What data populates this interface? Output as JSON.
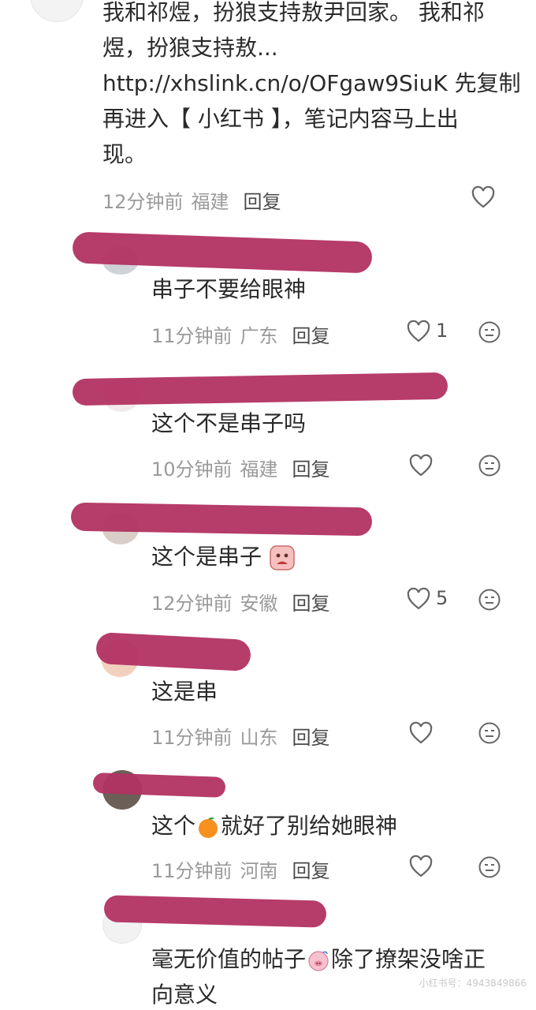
{
  "top_comment": {
    "lines": [
      "我和祁煜，扮狼支持敖尹回家。 我和祁",
      "煜，扮狼支持敖...",
      "http://xhslink.cn/o/OFgaw9SiuK 先复制",
      "再进入【 小红书 】，笔记内容马上出",
      "现。"
    ],
    "time": "12分钟前",
    "location": "福建",
    "reply_label": "回复"
  },
  "replies": [
    {
      "text": "串子不要给眼神",
      "time": "11分钟前",
      "location": "广东",
      "reply_label": "回复",
      "likes": "1"
    },
    {
      "text": "这个不是串子吗",
      "time": "10分钟前",
      "location": "福建",
      "reply_label": "回复",
      "likes": ""
    },
    {
      "text": "这个是串子",
      "time": "12分钟前",
      "location": "安徽",
      "reply_label": "回复",
      "likes": "5"
    },
    {
      "text": "这是串",
      "time": "11分钟前",
      "location": "山东",
      "reply_label": "回复",
      "likes": ""
    },
    {
      "text_before": "这个",
      "text_after": "就好了别给她眼神",
      "time": "11分钟前",
      "location": "河南",
      "reply_label": "回复",
      "likes": ""
    },
    {
      "text_before": "毫无价值的帖子",
      "text_after": "除了撩架没啥正",
      "text_line2": "向意义"
    }
  ],
  "watermark": "小红书号：4943849866",
  "colors": {
    "redaction": "#b23262",
    "meta_gray": "#9a9a9a",
    "reply_dark": "#4a4a4a",
    "icon_gray": "#666666"
  }
}
